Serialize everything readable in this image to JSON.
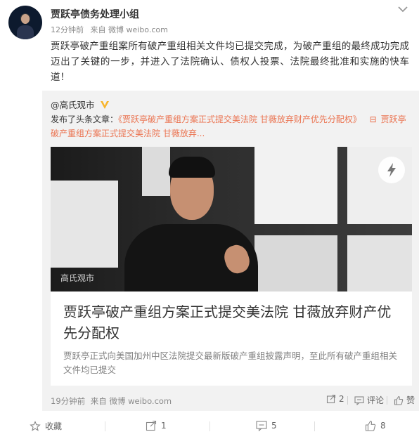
{
  "post": {
    "author": "贾跃亭债务处理小组",
    "time": "12分钟前",
    "source": "来自 微博 weibo.com",
    "text": "贾跃亭破产重组案所有破产重组相关文件均已提交完成，为破产重组的最终成功完成迈出了关键的一步，并进入了法院确认、债权人投票、法院最终批准和实施的快车道！"
  },
  "repost": {
    "author": "@高氏观市",
    "prefix": "发布了头条文章：",
    "article_link": "《贾跃亭破产重组方案正式提交美法院 甘薇放弃财产优先分配权》",
    "link_icon": "⊟",
    "link_text": "贾跃亭破产重组方案正式提交美法院 甘薇放弃...",
    "card": {
      "watermark": "高氏观市",
      "title": "贾跃亭破产重组方案正式提交美法院 甘薇放弃财产优先分配权",
      "description": "贾跃亭正式向美国加州中区法院提交最新版破产重组披露声明，至此所有破产重组相关文件均已提交"
    },
    "time": "19分钟前",
    "source": "来自 微博 weibo.com",
    "repost_count": "2",
    "comment_label": "评论",
    "like_label": "赞"
  },
  "actions": {
    "favorite_label": "收藏",
    "repost_count": "1",
    "comment_count": "5",
    "like_count": "8"
  },
  "colors": {
    "link": "#eb7350",
    "vip": "#f7b52c"
  }
}
